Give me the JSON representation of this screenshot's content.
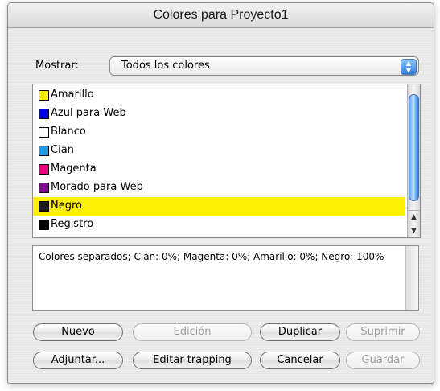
{
  "window": {
    "title": "Colores para Proyecto1"
  },
  "show": {
    "label": "Mostrar:",
    "value": "Todos los colores"
  },
  "colors": [
    {
      "label": "Amarillo",
      "swatch": "#ffee00",
      "selected": false
    },
    {
      "label": "Azul para Web",
      "swatch": "#0000e6",
      "selected": false
    },
    {
      "label": "Blanco",
      "swatch": "#ffffff",
      "selected": false
    },
    {
      "label": "Cian",
      "swatch": "#1e9be6",
      "selected": false
    },
    {
      "label": "Magenta",
      "swatch": "#e6007e",
      "selected": false
    },
    {
      "label": "Morado para Web",
      "swatch": "#7d0a8c",
      "selected": false
    },
    {
      "label": "Negro",
      "swatch": "#1c1c1c",
      "selected": true
    },
    {
      "label": "Registro",
      "swatch": "#000000",
      "selected": false
    }
  ],
  "selection_color": "#fcf100",
  "description": "Colores separados; Cian: 0%; Magenta: 0%; Amarillo: 0%; Negro: 100%",
  "buttons": {
    "nuevo": "Nuevo",
    "edicion": "Edición",
    "duplicar": "Duplicar",
    "suprimir": "Suprimir",
    "adjuntar": "Adjuntar...",
    "editar_trapping": "Editar trapping",
    "cancelar": "Cancelar",
    "guardar": "Guardar"
  }
}
